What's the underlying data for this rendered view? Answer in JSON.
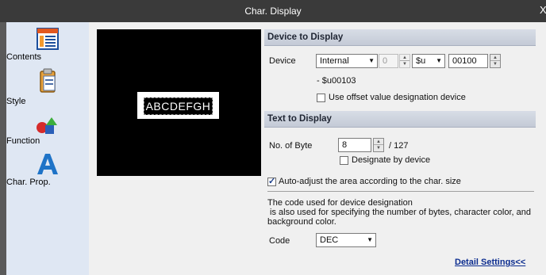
{
  "window": {
    "title": "Char. Display",
    "close_glyph": "X"
  },
  "sidebar": {
    "items": [
      {
        "label": "Contents",
        "icon": "contents-icon"
      },
      {
        "label": "Style",
        "icon": "style-icon"
      },
      {
        "label": "Function",
        "icon": "function-icon"
      },
      {
        "label": "Char. Prop.",
        "icon": "char-prop-icon"
      }
    ]
  },
  "preview": {
    "text": "ABCDEFGH"
  },
  "device_section": {
    "title": "Device to Display",
    "device_label": "Device",
    "type_value": "Internal",
    "num_value": "0",
    "prefix_value": "$u",
    "address_value": "00100",
    "range_text": "- $u00103",
    "offset_label": "Use offset value designation device",
    "offset_checked": false
  },
  "text_section": {
    "title": "Text to Display",
    "bytes_label": "No. of Byte",
    "bytes_value": "8",
    "bytes_max": "/ 127",
    "designate_label": "Designate by device",
    "designate_checked": false,
    "auto_adjust_label": "Auto-adjust the area according to the char. size",
    "auto_adjust_checked": true,
    "note_line1": "The code used for device designation",
    "note_line2": " is also used for specifying the number of bytes, character color, and",
    "note_line3": "background color.",
    "code_label": "Code",
    "code_value": "DEC",
    "detail_link": "Detail Settings<<"
  }
}
